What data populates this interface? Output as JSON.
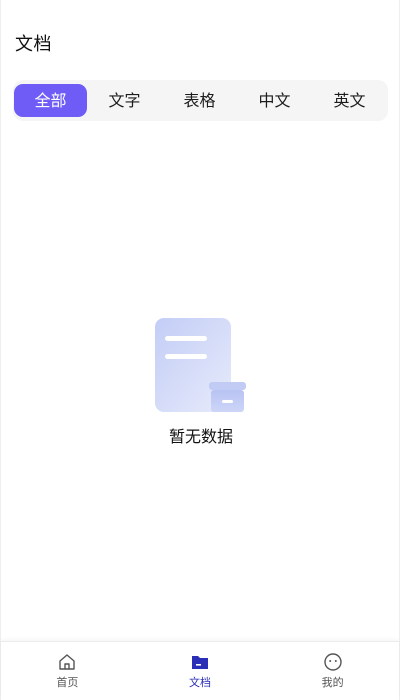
{
  "header": {
    "title": "文档"
  },
  "tabs": [
    {
      "label": "全部",
      "active": true
    },
    {
      "label": "文字",
      "active": false
    },
    {
      "label": "表格",
      "active": false
    },
    {
      "label": "中文",
      "active": false
    },
    {
      "label": "英文",
      "active": false
    }
  ],
  "empty_state": {
    "icon": "empty-document-box-icon",
    "text": "暂无数据"
  },
  "bottom_nav": {
    "items": [
      {
        "label": "首页",
        "icon": "home-icon",
        "active": false
      },
      {
        "label": "文档",
        "icon": "folder-icon",
        "active": true
      },
      {
        "label": "我的",
        "icon": "smiley-face-icon",
        "active": false
      }
    ]
  },
  "colors": {
    "accent": "#6f5cf6",
    "nav_active": "#2b2fb8",
    "tab_bar_bg": "#f5f5f5"
  }
}
